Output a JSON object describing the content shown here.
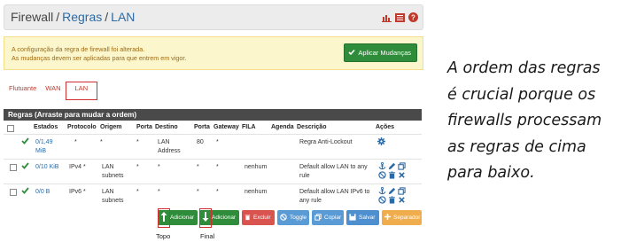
{
  "header": {
    "root": "Firewall",
    "crumbs": [
      "Regras",
      "LAN"
    ],
    "icons": [
      "chart-icon",
      "list-icon",
      "help-icon"
    ]
  },
  "alert": {
    "line1": "A configuração da regra de firewall foi alterada.",
    "line2": "As mudanças devem ser aplicadas para que entrem em vigor.",
    "apply_label": "Aplicar Mudanças"
  },
  "tabs": [
    "Flutuante",
    "WAN",
    "LAN"
  ],
  "table": {
    "title": "Regras (Arraste para mudar a ordem)",
    "columns": [
      "Estados",
      "Protocolo",
      "Origem",
      "Porta",
      "Destino",
      "Porta",
      "Gateway",
      "FILA",
      "Agenda",
      "Descrição",
      "Ações"
    ],
    "rows": [
      {
        "states": "0/1,49 MiB",
        "protocol": "*",
        "source": "*",
        "sport": "*",
        "dest": "LAN Address",
        "dport": "80",
        "gateway": "*",
        "queue": "",
        "schedule": "",
        "desc": "Regra Anti-Lockout"
      },
      {
        "states": "0/10 KiB",
        "protocol": "IPv4 *",
        "source": "LAN subnets",
        "sport": "*",
        "dest": "*",
        "dport": "*",
        "gateway": "*",
        "queue": "nenhum",
        "schedule": "",
        "desc": "Default allow LAN to any rule"
      },
      {
        "states": "0/0 B",
        "protocol": "IPv6 *",
        "source": "LAN subnets",
        "sport": "*",
        "dest": "*",
        "dport": "*",
        "gateway": "*",
        "queue": "nenhum",
        "schedule": "",
        "desc": "Default allow LAN IPv6 to any rule"
      }
    ]
  },
  "buttons": {
    "add_top": "Adicionar",
    "add_bottom": "Adicionar",
    "delete": "Excluir",
    "toggle": "Toggle",
    "copy": "Copiar",
    "save": "Salvar",
    "separator": "Separador"
  },
  "captions": {
    "top": "Topo",
    "bottom": "Final"
  },
  "note": {
    "lines": [
      "A ordem das regras",
      "é crucial porque os",
      "firewalls processam",
      "as regras de cima",
      "para baixo."
    ]
  },
  "colors": {
    "accent": "#2c6aa6",
    "danger": "#d12f2f",
    "success": "#2f8c3a",
    "warning_bg": "#fcf6cc"
  }
}
